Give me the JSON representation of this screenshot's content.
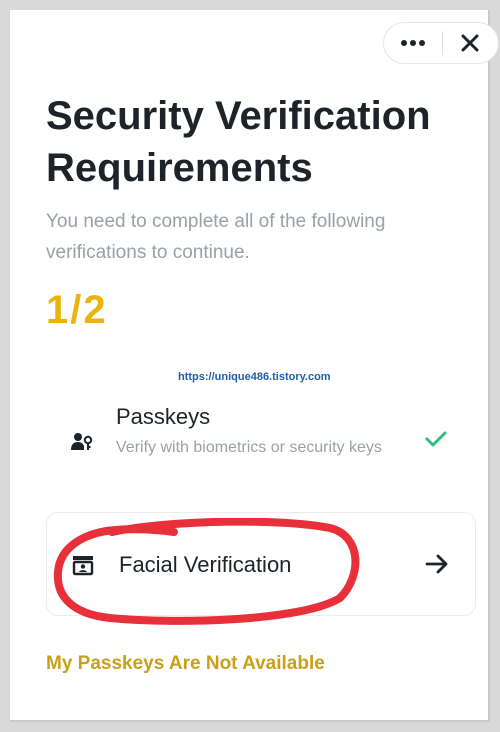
{
  "header": {
    "more_icon": "ellipsis-icon",
    "close_icon": "close-icon"
  },
  "title": "Security Verification Requirements",
  "subtitle": "You need to complete all of the following verifications to continue.",
  "progress": "1/2",
  "watermark": "https://unique486.tistory.com",
  "verifications": [
    {
      "title": "Passkeys",
      "description": "Verify with biometrics or security keys",
      "icon": "passkey-icon",
      "status": "completed",
      "status_icon": "check-icon"
    },
    {
      "title": "Facial Verification",
      "icon": "face-id-icon",
      "status": "pending",
      "action_icon": "arrow-right-icon"
    }
  ],
  "footer_link": "My Passkeys Are Not Available",
  "colors": {
    "accent": "#e9b50d",
    "link": "#c9a019",
    "check": "#2ebd85",
    "annotation": "#e8303a",
    "text_primary": "#1e2329",
    "text_secondary": "#9aa0a8"
  }
}
